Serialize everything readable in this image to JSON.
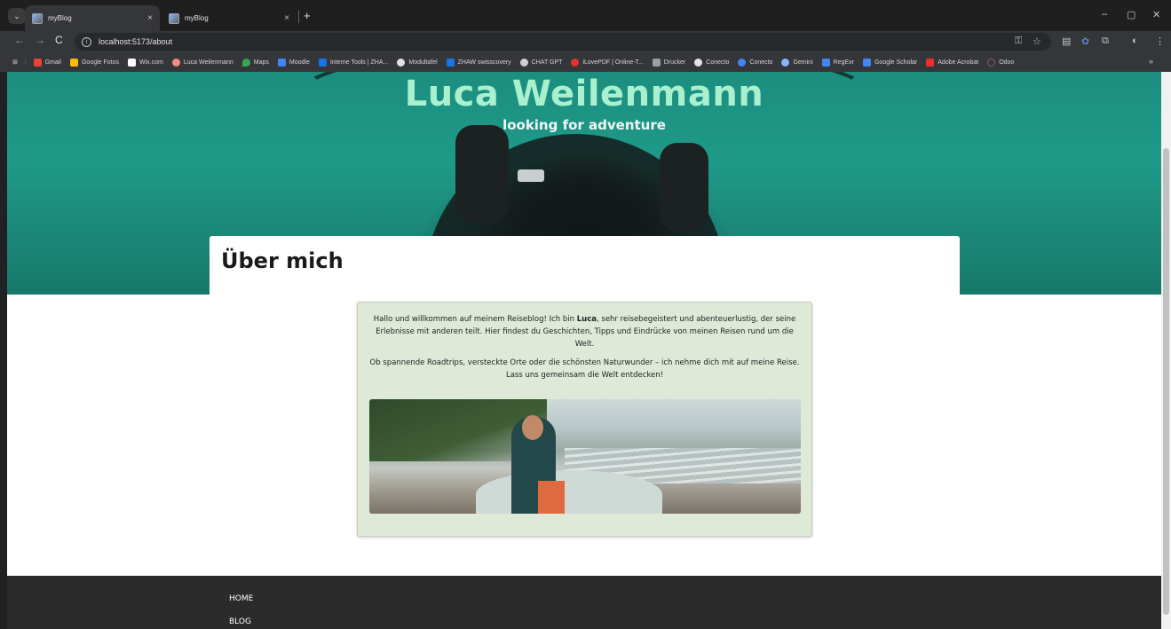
{
  "browser": {
    "tabs": [
      {
        "title": "myBlog",
        "active": true
      },
      {
        "title": "myBlog",
        "active": false
      }
    ],
    "tab_close_glyph": "×",
    "new_tab_glyph": "+",
    "tab_list_glyph": "⌄",
    "window_controls": [
      "–",
      "▢",
      "✕"
    ],
    "url": "localhost:5173/about",
    "nav": {
      "back": "←",
      "forward": "→",
      "reload": "C"
    },
    "toolbar_icons": [
      "key-icon",
      "star-icon",
      "reader-icon",
      "extension-icon",
      "puzzle-icon",
      "profile-icon",
      "menu-icon"
    ],
    "bookmarks": [
      {
        "label": "Gmail",
        "color": "#ea4335"
      },
      {
        "label": "Google Fotos",
        "color": "#fbbc04"
      },
      {
        "label": "Wix.com",
        "color": "#ffffff"
      },
      {
        "label": "Luca Weilenmann",
        "color": "#f28b82"
      },
      {
        "label": "Maps",
        "color": "#34a853"
      },
      {
        "label": "Moodle",
        "color": "#4285f4"
      },
      {
        "label": "Interne Tools | ZHA...",
        "color": "#1a73e8"
      },
      {
        "label": "Modultafel",
        "color": "#e3e3e3"
      },
      {
        "label": "ZHAW swisscovery",
        "color": "#1a73e8"
      },
      {
        "label": "CHAT GPT",
        "color": "#cfcfcf"
      },
      {
        "label": "iLovePDF | Online-T...",
        "color": "#e5322d"
      },
      {
        "label": "Drucker",
        "color": "#9aa0a6"
      },
      {
        "label": "Conecto",
        "color": "#e3e3e3"
      },
      {
        "label": "Conecto",
        "color": "#4285f4"
      },
      {
        "label": "Gemini",
        "color": "#8ab4f8"
      },
      {
        "label": "RegExr",
        "color": "#4285f4"
      },
      {
        "label": "Google Scholar",
        "color": "#4285f4"
      },
      {
        "label": "Adobe Acrobat",
        "color": "#e5322d"
      },
      {
        "label": "Odoo",
        "color": "#875a7b"
      }
    ],
    "bookmarks_more": "»"
  },
  "page": {
    "hero": {
      "title": "Luca Weilenmann",
      "subtitle": "looking for adventure"
    },
    "heading": "Über mich",
    "intro": {
      "p1_before": "Hallo und willkommen auf meinem Reiseblog! Ich bin ",
      "p1_bold": "Luca",
      "p1_after": ", sehr reisebegeistert und abenteuerlustig, der seine Erlebnisse mit anderen teilt. Hier findest du Geschichten, Tipps und Eindrücke von meinen Reisen rund um die Welt.",
      "p2": "Ob spannende Roadtrips, versteckte Orte oder die schönsten Naturwunder – ich nehme dich mit auf meine Reise. Lass uns gemeinsam die Welt entdecken!"
    },
    "footer": {
      "links": [
        "HOME",
        "BLOG"
      ]
    }
  },
  "colors": {
    "hero_title": "#a9f0cf",
    "content_box": "#dfe9d7",
    "footer": "#2b2b2b"
  }
}
